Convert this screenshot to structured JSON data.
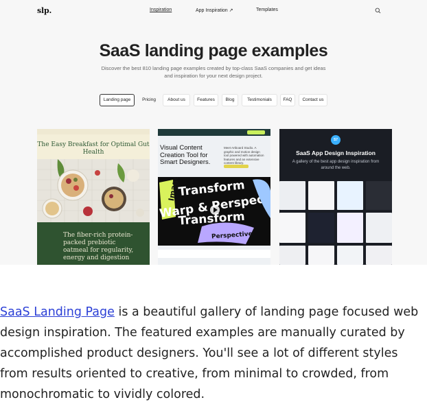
{
  "nav": {
    "logo": "slp.",
    "links": [
      "Inspiration",
      "App Inspiration ↗",
      "Templates"
    ],
    "search_icon": "search-icon"
  },
  "hero": {
    "title": "SaaS landing page examples",
    "subtitle": "Discover the best 810 landing page examples created by top-class SaaS companies and get ideas and inspiration for your next design project."
  },
  "filters": [
    "Landing page",
    "Pricing",
    "About us",
    "Features",
    "Blog",
    "Testimonials",
    "FAQ",
    "Contact us"
  ],
  "active_filter": "Landing page",
  "cards": [
    {
      "heading": "The Easy Breakfast for Optimal Gut Health",
      "panel_text": "The fiber-rich protein-packed prebiotic oatmeal for regularity, energy and digestion",
      "accent": "#2f5330"
    },
    {
      "heading": "Visual Content Creation Tool for Smart Designers.",
      "side_text": "Meet Artboard Studio. A graphic and motion design tool powered with automation features and an extensive content library.",
      "art_words": [
        "Image",
        "Transform",
        "Warp & Perspective",
        "Transform",
        "Perspective"
      ],
      "accent": "#c8ef5c"
    },
    {
      "badge": "S7",
      "title": "SaaS App Design Inspiration",
      "subtitle": "A gallery of the best app design inspiration from around the web.",
      "accent": "#3ab0ff"
    }
  ],
  "description": {
    "link_text": "SaaS Landing Page",
    "body": " is a beautiful gallery of landing page focused web design inspiration. The featured examples are manually curated by accomplished product designers. You'll see a lot of different styles from results oriented to creative, from minimal to crowded, from monochromatic to vividly colored.",
    "link_color": "#2b3fd6"
  }
}
